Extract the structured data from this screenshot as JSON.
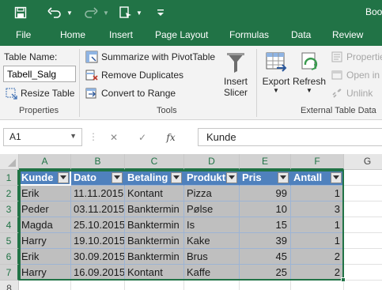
{
  "title_bar": {
    "title": "Boo"
  },
  "ribbon_tabs": [
    "File",
    "Home",
    "Insert",
    "Page Layout",
    "Formulas",
    "Data",
    "Review"
  ],
  "properties": {
    "table_name_label": "Table Name:",
    "table_name_value": "Tabell_Salg",
    "resize_label": "Resize Table",
    "group_label": "Properties"
  },
  "tools": {
    "pivot_label": "Summarize with PivotTable",
    "remove_dup_label": "Remove Duplicates",
    "convert_label": "Convert to Range",
    "slicer_label_1": "Insert",
    "slicer_label_2": "Slicer",
    "group_label": "Tools"
  },
  "external": {
    "export_label": "Export",
    "refresh_label": "Refresh",
    "properties_label": "Propertie",
    "open_browser_label": "Open in B",
    "unlink_label": "Unlink",
    "group_label": "External Table Data"
  },
  "formula_bar": {
    "name_box": "A1",
    "cancel_symbol": "✕",
    "enter_symbol": "✓",
    "fx_symbol": "fx",
    "content": "Kunde"
  },
  "columns": [
    "A",
    "B",
    "C",
    "D",
    "E",
    "F",
    "G"
  ],
  "rows": [
    "1",
    "2",
    "3",
    "4",
    "5",
    "6",
    "7",
    "8"
  ],
  "table": {
    "headers": [
      "Kunde",
      "Dato",
      "Betaling",
      "Produkt",
      "Pris",
      "Antall"
    ],
    "rows": [
      [
        "Erik",
        "11.11.2015",
        "Kontant",
        "Pizza",
        "99",
        "1"
      ],
      [
        "Peder",
        "03.11.2015",
        "Banktermin",
        "Pølse",
        "10",
        "3"
      ],
      [
        "Magda",
        "25.10.2015",
        "Banktermin",
        "Is",
        "15",
        "1"
      ],
      [
        "Harry",
        "19.10.2015",
        "Banktermin",
        "Kake",
        "39",
        "1"
      ],
      [
        "Erik",
        "30.09.2015",
        "Banktermin",
        "Brus",
        "45",
        "2"
      ],
      [
        "Harry",
        "16.09.2015",
        "Kontant",
        "Kaffe",
        "25",
        "2"
      ]
    ]
  },
  "colors": {
    "excel_green": "#217346",
    "table_header": "#4f81bd",
    "table_row": "#bfbfbf"
  }
}
